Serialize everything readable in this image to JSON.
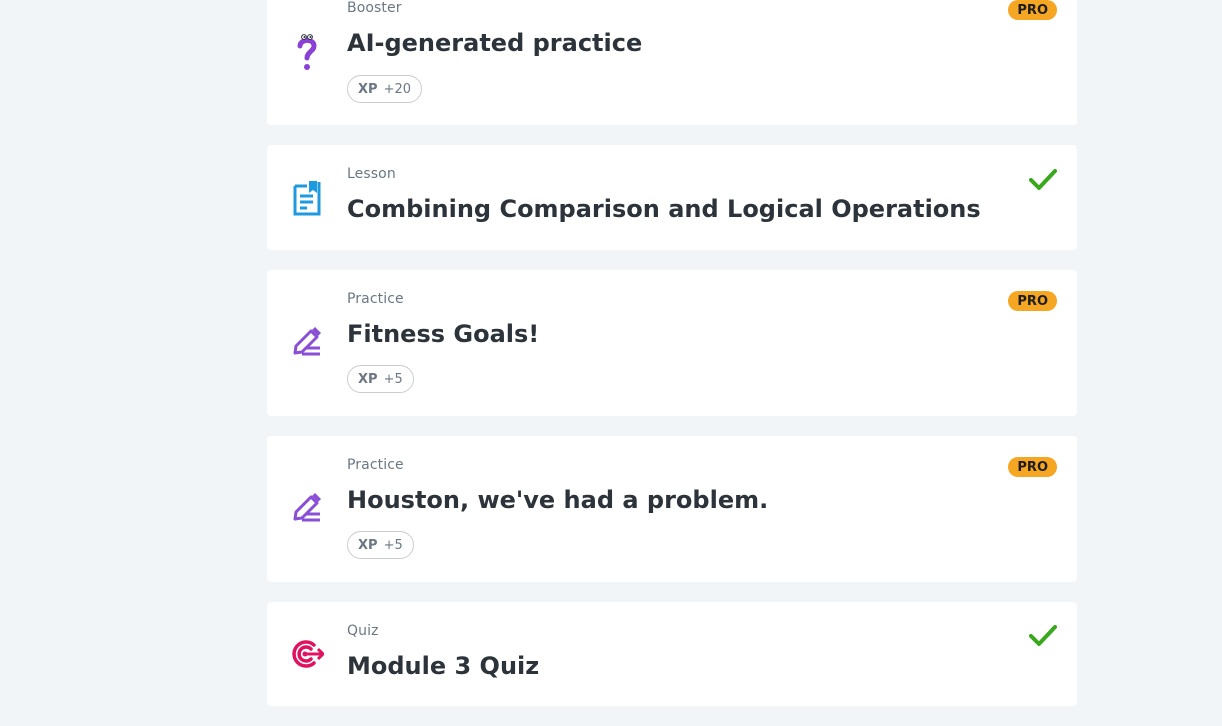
{
  "items": [
    {
      "type": "Booster",
      "title": "AI-generated practice",
      "icon": "question-mark-icon",
      "xp_label": "XP",
      "xp_value": "+20",
      "badge": "PRO"
    },
    {
      "type": "Lesson",
      "title": "Combining Comparison and Logical Operations",
      "icon": "lesson-document-icon",
      "completed": true
    },
    {
      "type": "Practice",
      "title": "Fitness Goals!",
      "icon": "pencil-icon",
      "xp_label": "XP",
      "xp_value": "+5",
      "badge": "PRO"
    },
    {
      "type": "Practice",
      "title": "Houston, we've had a problem.",
      "icon": "pencil-icon",
      "xp_label": "XP",
      "xp_value": "+5",
      "badge": "PRO"
    },
    {
      "type": "Quiz",
      "title": "Module 3 Quiz",
      "icon": "target-icon",
      "completed": true
    }
  ],
  "colors": {
    "background": "#f2f5f7",
    "card": "#ffffff",
    "pro_badge": "#f5a623",
    "check": "#3aa81c",
    "booster_icon": "#8a3fd6",
    "lesson_icon": "#1e9be0",
    "practice_icon": "#8a4fd6",
    "quiz_icon": "#e0115f"
  }
}
